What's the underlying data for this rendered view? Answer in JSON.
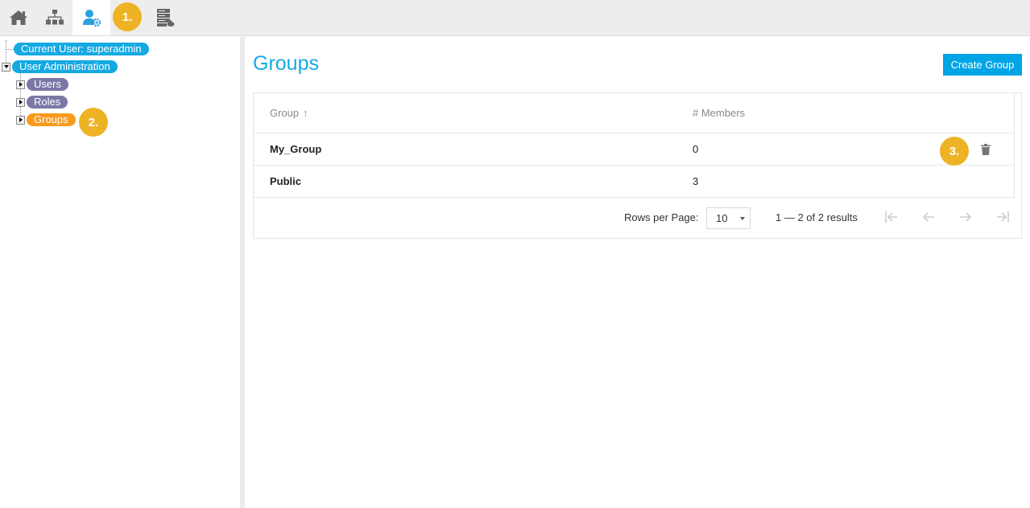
{
  "toolbar": {
    "items": [
      {
        "name": "home",
        "icon": "home-icon"
      },
      {
        "name": "hierarchy",
        "icon": "sitemap-icon"
      },
      {
        "name": "user-admin",
        "icon": "user-gear-icon",
        "active": true
      },
      {
        "name": "server",
        "icon": "server-cloud-icon"
      }
    ],
    "active_color": "#2b9fe0"
  },
  "markers": {
    "m1": "1.",
    "m2": "2.",
    "m3": "3."
  },
  "tree": {
    "current_user": "Current User: superadmin",
    "user_admin": "User Administration",
    "children": [
      "Users",
      "Roles",
      "Groups"
    ],
    "selected": "Groups"
  },
  "page": {
    "title": "Groups",
    "create_button": "Create Group"
  },
  "table": {
    "columns": [
      "Group",
      "# Members"
    ],
    "sort_indicator": "↑",
    "rows": [
      {
        "group": "My_Group",
        "members": "0"
      },
      {
        "group": "Public",
        "members": "3"
      }
    ]
  },
  "pagination": {
    "rows_per_page_label": "Rows per Page:",
    "rows_per_page_value": "10",
    "results_text": "1 — 2 of 2 results"
  },
  "colors": {
    "accent": "#14a9e3",
    "button": "#00a5e6",
    "pill_purple": "#7b78a8",
    "pill_orange": "#f89a1c",
    "marker": "#eeb324"
  }
}
